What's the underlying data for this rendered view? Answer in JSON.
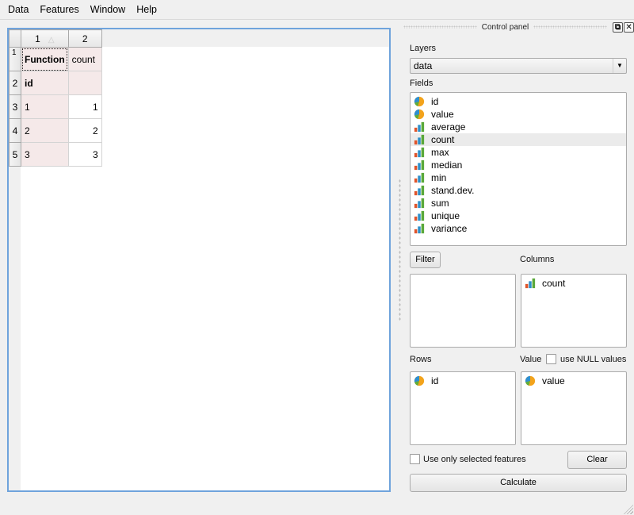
{
  "menu": [
    "Data",
    "Features",
    "Window",
    "Help"
  ],
  "table": {
    "column_headers": [
      "1",
      "2"
    ],
    "row_headers": [
      "1",
      "2",
      "3",
      "4",
      "5"
    ],
    "rows": [
      [
        "Function",
        "count"
      ],
      [
        "id",
        ""
      ],
      [
        "1",
        "1"
      ],
      [
        "2",
        "2"
      ],
      [
        "3",
        "3"
      ]
    ],
    "sort_indicator": "△"
  },
  "control_panel": {
    "title": "Control panel",
    "float_icon": "float-icon",
    "close_icon": "close-icon",
    "layers_label": "Layers",
    "layer_selected": "data",
    "fields_label": "Fields",
    "fields": [
      {
        "name": "id",
        "icon": "pie-field-icon"
      },
      {
        "name": "value",
        "icon": "pie-field-icon"
      },
      {
        "name": "average",
        "icon": "bar-chart-function-icon"
      },
      {
        "name": "count",
        "icon": "bar-chart-function-icon",
        "highlighted": true
      },
      {
        "name": "max",
        "icon": "bar-chart-function-icon"
      },
      {
        "name": "median",
        "icon": "bar-chart-function-icon"
      },
      {
        "name": "min",
        "icon": "bar-chart-function-icon"
      },
      {
        "name": "stand.dev.",
        "icon": "bar-chart-function-icon"
      },
      {
        "name": "sum",
        "icon": "bar-chart-function-icon"
      },
      {
        "name": "unique",
        "icon": "bar-chart-function-icon"
      },
      {
        "name": "variance",
        "icon": "bar-chart-function-icon"
      }
    ],
    "filter_button": "Filter",
    "columns_label": "Columns",
    "columns_items": [
      {
        "name": "count",
        "icon": "bar-chart-function-icon"
      }
    ],
    "filter_items": [],
    "rows_label": "Rows",
    "rows_items": [
      {
        "name": "id",
        "icon": "pie-field-icon"
      }
    ],
    "value_label": "Value",
    "use_null_label": "use NULL values",
    "use_null_checked": false,
    "value_items": [
      {
        "name": "value",
        "icon": "pie-field-icon"
      }
    ],
    "use_selected_label": "Use only selected features",
    "use_selected_checked": false,
    "clear_button": "Clear",
    "calculate_button": "Calculate"
  }
}
